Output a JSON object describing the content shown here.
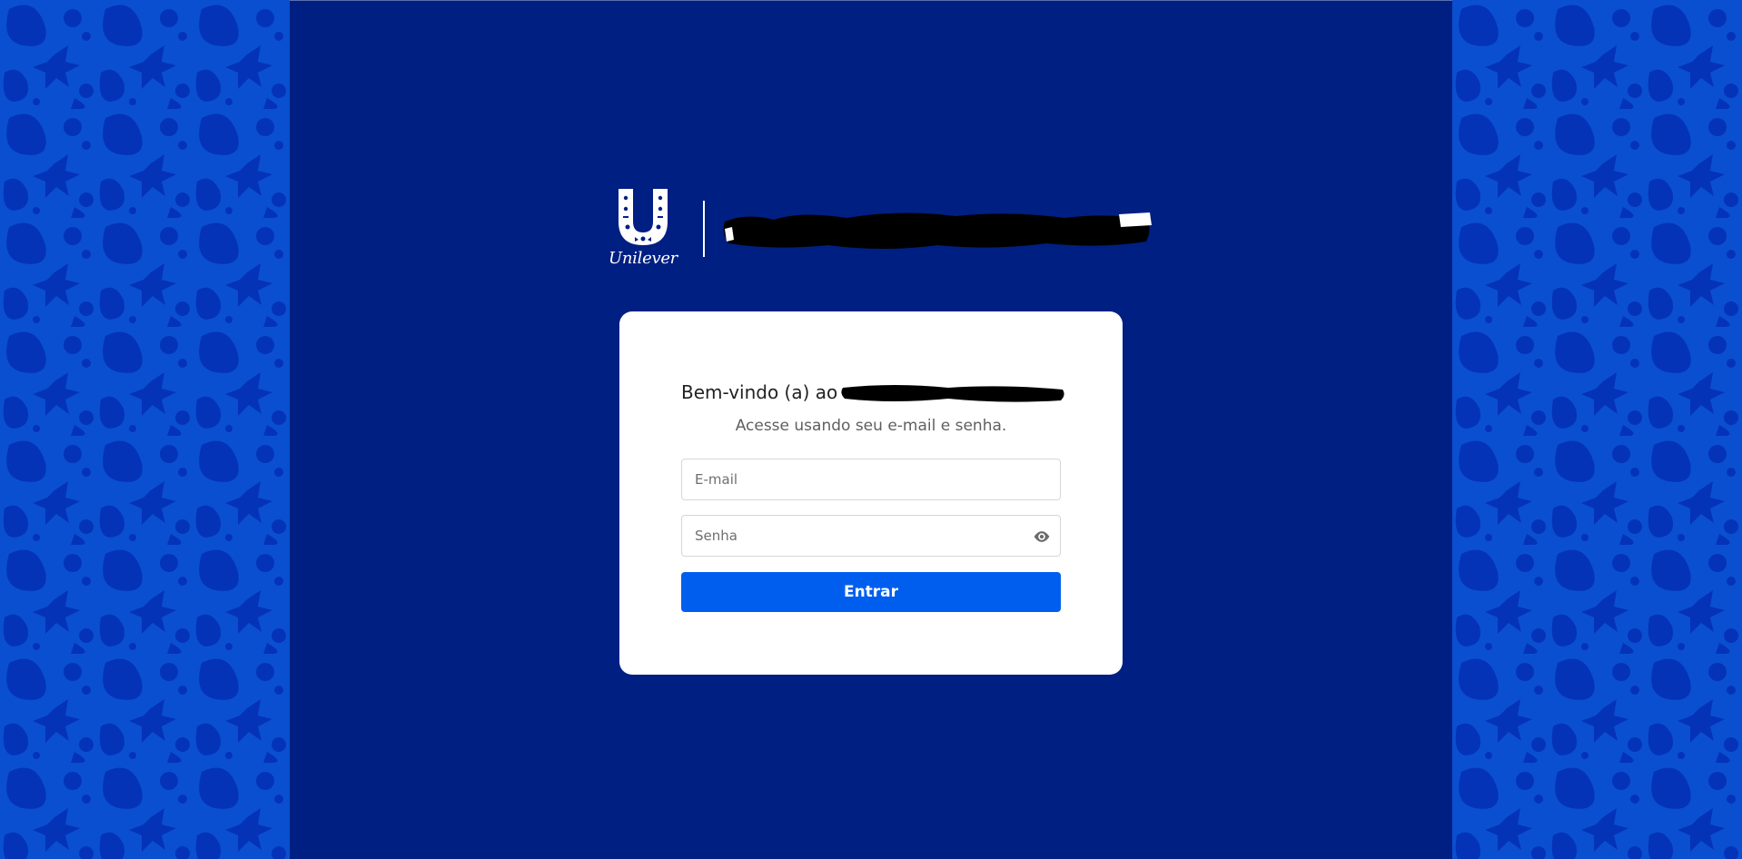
{
  "brand": {
    "logo_text": "Unilever",
    "title_redacted": true
  },
  "login": {
    "welcome_prefix": "Bem-vindo (a) ao",
    "subtitle": "Acesse usando seu e-mail e senha.",
    "email_placeholder": "E-mail",
    "email_value": "",
    "password_placeholder": "Senha",
    "password_value": "",
    "submit_label": "Entrar"
  },
  "icons": {
    "logo": "unilever-u-logo-icon",
    "password_toggle": "eye-icon"
  },
  "colors": {
    "background": "#001f82",
    "side_pattern": "#0a4fd0",
    "pattern_motif": "#0433b8",
    "card": "#ffffff",
    "button": "#005eef",
    "redaction": "#000000"
  }
}
